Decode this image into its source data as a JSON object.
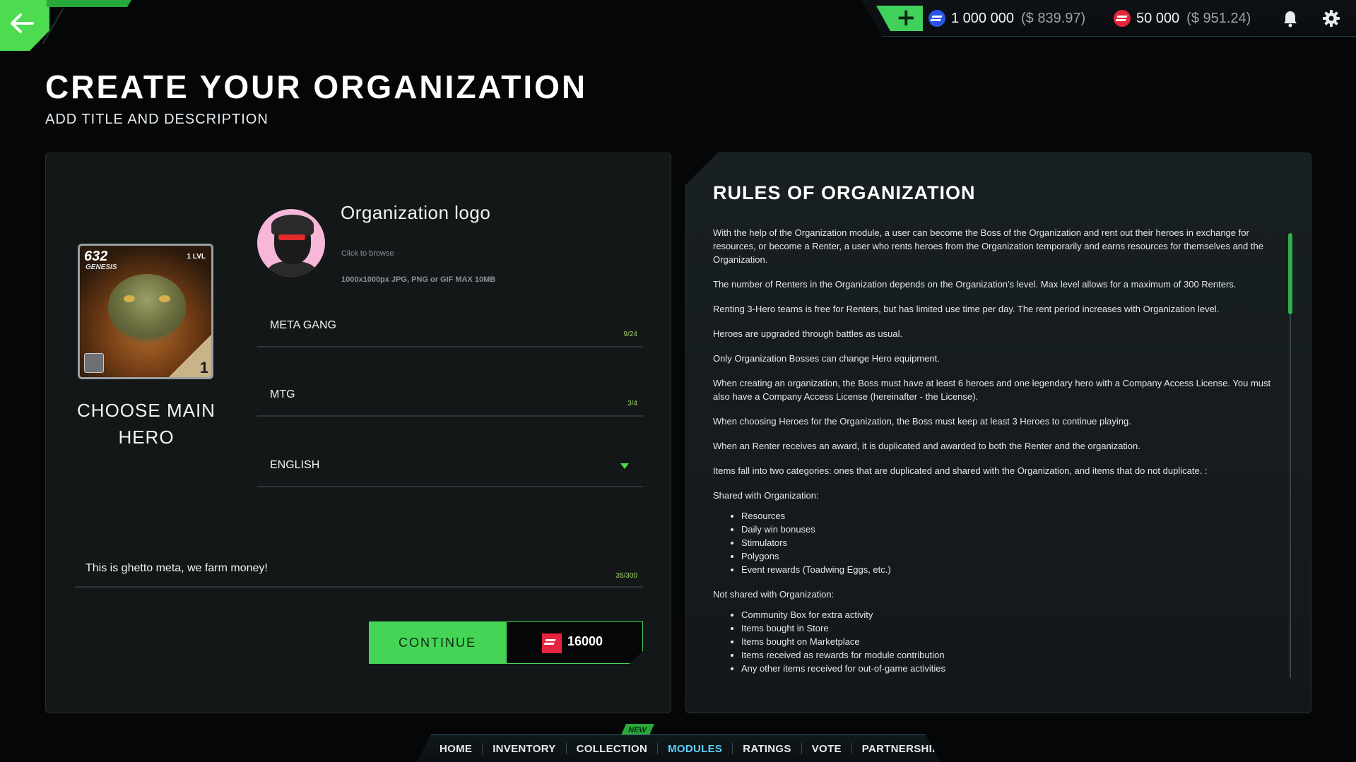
{
  "topbar": {
    "add_label": "+",
    "currency_blue": {
      "amount": "1 000 000",
      "usd": "($ 839.97)",
      "color": "#2a54e8"
    },
    "currency_red": {
      "amount": "50 000",
      "usd": "($ 951.24)",
      "color": "#e5253d"
    }
  },
  "page": {
    "title": "CREATE YOUR ORGANIZATION",
    "subtitle": "ADD TITLE AND DESCRIPTION"
  },
  "hero": {
    "id": "632",
    "edition": "GENESIS",
    "level": "1 LVL",
    "number": "1",
    "choose_label": "CHOOSE MAIN HERO"
  },
  "logo": {
    "title": "Organization logo",
    "hint": "Click to browse",
    "spec": "1000x1000px JPG, PNG or GIF MAX 10MB"
  },
  "form": {
    "name": {
      "value": "META GANG",
      "counter": "9/24"
    },
    "tag": {
      "value": "MTG",
      "counter": "3/4"
    },
    "language": {
      "value": "ENGLISH"
    },
    "description": {
      "value": "This is ghetto meta, we farm money!",
      "counter": "35/300"
    }
  },
  "actions": {
    "continue_label": "CONTINUE",
    "price": "16000"
  },
  "rules": {
    "title": "RULES OF ORGANIZATION",
    "p1": "With the help of the Organization module, a user can become the Boss of the Organization and rent out their heroes in exchange for resources, or become a Renter, a user who rents heroes from the Organization temporarily and earns resources for themselves and the Organization.",
    "p2": "The number of Renters in the Organization depends on the Organization’s level. Max level allows for a maximum of 300 Renters.",
    "p3": "Renting 3-Hero teams is free for Renters, but has limited use time per day. The rent period increases with Organization level.",
    "p4": "Heroes are upgraded through battles as usual.",
    "p5": "Only Organization Bosses can change Hero equipment.",
    "p6": "When creating an organization, the Boss must have at least 6 heroes and one legendary hero with a Company Access License. You must also have a Company Access License (hereinafter - the License).",
    "p7": "When choosing Heroes for the Organization, the Boss must keep at least 3 Heroes to continue playing.",
    "p8": "When an Renter receives an award, it is duplicated and awarded to both the Renter and the organization.",
    "p9": "Items fall into two categories: ones that are duplicated and shared with the Organization, and items that do not duplicate. :",
    "shared_heading": "Shared with Organization:",
    "shared": [
      "Resources",
      "Daily win bonuses",
      "Stimulators",
      "Polygons",
      "Event rewards (Toadwing Eggs, etc.)"
    ],
    "not_shared_heading": "Not shared with Organization:",
    "not_shared": [
      "Community Box for extra activity",
      "Items bought in Store",
      "Items bought on Marketplace",
      "Items received as rewards for module contribution",
      "Any other items received for out-of-game activities"
    ]
  },
  "nav": {
    "new_badge": "NEW",
    "items": [
      "HOME",
      "INVENTORY",
      "COLLECTION",
      "MODULES",
      "RATINGS",
      "VOTE",
      "PARTNERSHIP"
    ],
    "active": "MODULES"
  },
  "colors": {
    "accent": "#45d455",
    "active_nav": "#5fd2ff"
  }
}
